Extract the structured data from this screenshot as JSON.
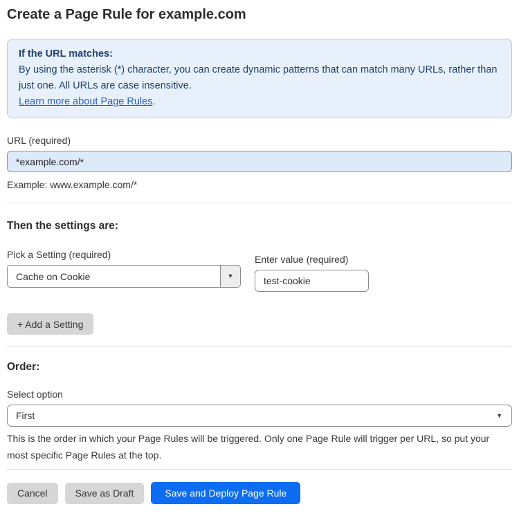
{
  "page": {
    "title": "Create a Page Rule for example.com"
  },
  "info_box": {
    "heading": "If the URL matches:",
    "body": "By using the asterisk (*) character, you can create dynamic patterns that can match many URLs, rather than just one. All URLs are case insensitive.",
    "link_label": "Learn more about Page Rules",
    "link_suffix": "."
  },
  "url_field": {
    "label": "URL (required)",
    "value": "*example.com/*",
    "hint": "Example: www.example.com/*"
  },
  "settings_section": {
    "heading": "Then the settings are:",
    "setting_select": {
      "label": "Pick a Setting (required)",
      "value": "Cache on Cookie"
    },
    "value_field": {
      "label": "Enter value (required)",
      "value": "test-cookie"
    },
    "add_setting_label": "+ Add a Setting"
  },
  "order_section": {
    "heading": "Order:",
    "select_label": "Select option",
    "selected_option": "First",
    "help_text": "This is the order in which your Page Rules will be triggered. Only one Page Rule will trigger per URL, so put your most specific Page Rules at the top."
  },
  "footer": {
    "cancel_label": "Cancel",
    "save_draft_label": "Save as Draft",
    "save_deploy_label": "Save and Deploy Page Rule"
  },
  "icons": {
    "dropdown_arrow": "▼"
  },
  "colors": {
    "primary_button": "#0d6df2",
    "info_box_background": "#e8f1fb",
    "info_box_border": "#abc9ec",
    "info_box_text": "#20406f",
    "link": "#2a62c4",
    "url_input_background": "#dceafa",
    "gray_button": "#d6d6d6"
  }
}
